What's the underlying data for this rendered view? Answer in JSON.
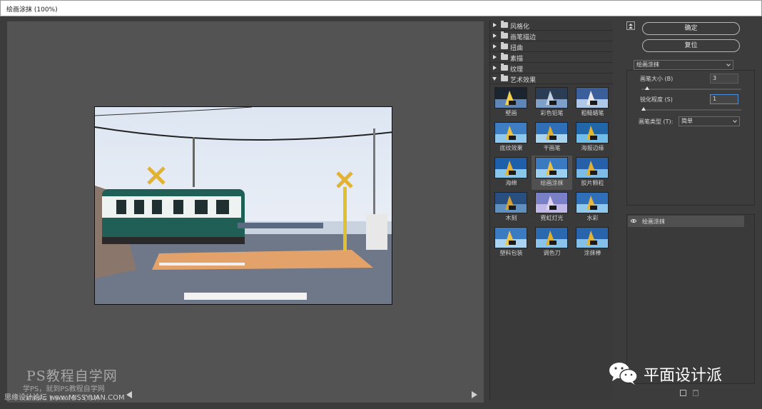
{
  "window": {
    "title": "绘画涂抹 (100%)"
  },
  "watermarks": {
    "site_title": "PS教程自学网",
    "site_sub": "学PS，就到PS教程自学网",
    "site_url": "WWW.16XX8.COM",
    "bottom": "思缘设计论坛 www.MISSYUAN.COM",
    "brand": "平面设计派"
  },
  "gallery": {
    "folders": [
      {
        "label": "风格化",
        "open": false
      },
      {
        "label": "画笔描边",
        "open": false
      },
      {
        "label": "扭曲",
        "open": false
      },
      {
        "label": "素描",
        "open": false
      },
      {
        "label": "纹理",
        "open": false
      },
      {
        "label": "艺术效果",
        "open": true
      }
    ],
    "filters": [
      {
        "label": "壁画"
      },
      {
        "label": "彩色铅笔"
      },
      {
        "label": "粗糙蜡笔"
      },
      {
        "label": "底纹效果"
      },
      {
        "label": "干画笔"
      },
      {
        "label": "海报边缘"
      },
      {
        "label": "海绵"
      },
      {
        "label": "绘画涂抹",
        "selected": true
      },
      {
        "label": "胶片颗粒"
      },
      {
        "label": "木刻"
      },
      {
        "label": "霓虹灯光"
      },
      {
        "label": "水彩"
      },
      {
        "label": "塑料包装"
      },
      {
        "label": "调色刀"
      },
      {
        "label": "涂抹棒"
      }
    ]
  },
  "settings": {
    "ok_label": "确定",
    "reset_label": "复位",
    "filter_select": "绘画涂抹",
    "brush_size_label": "画笔大小 (B)",
    "brush_size_value": "3",
    "brush_size_fraction": 0.06,
    "sharpness_label": "锐化程度 (S)",
    "sharpness_value": "1",
    "sharpness_fraction": 0.02,
    "brush_type_label": "画笔类型 (T):",
    "brush_type_value": "简单"
  },
  "layers": [
    {
      "name": "绘画涂抹",
      "visible": true
    }
  ]
}
